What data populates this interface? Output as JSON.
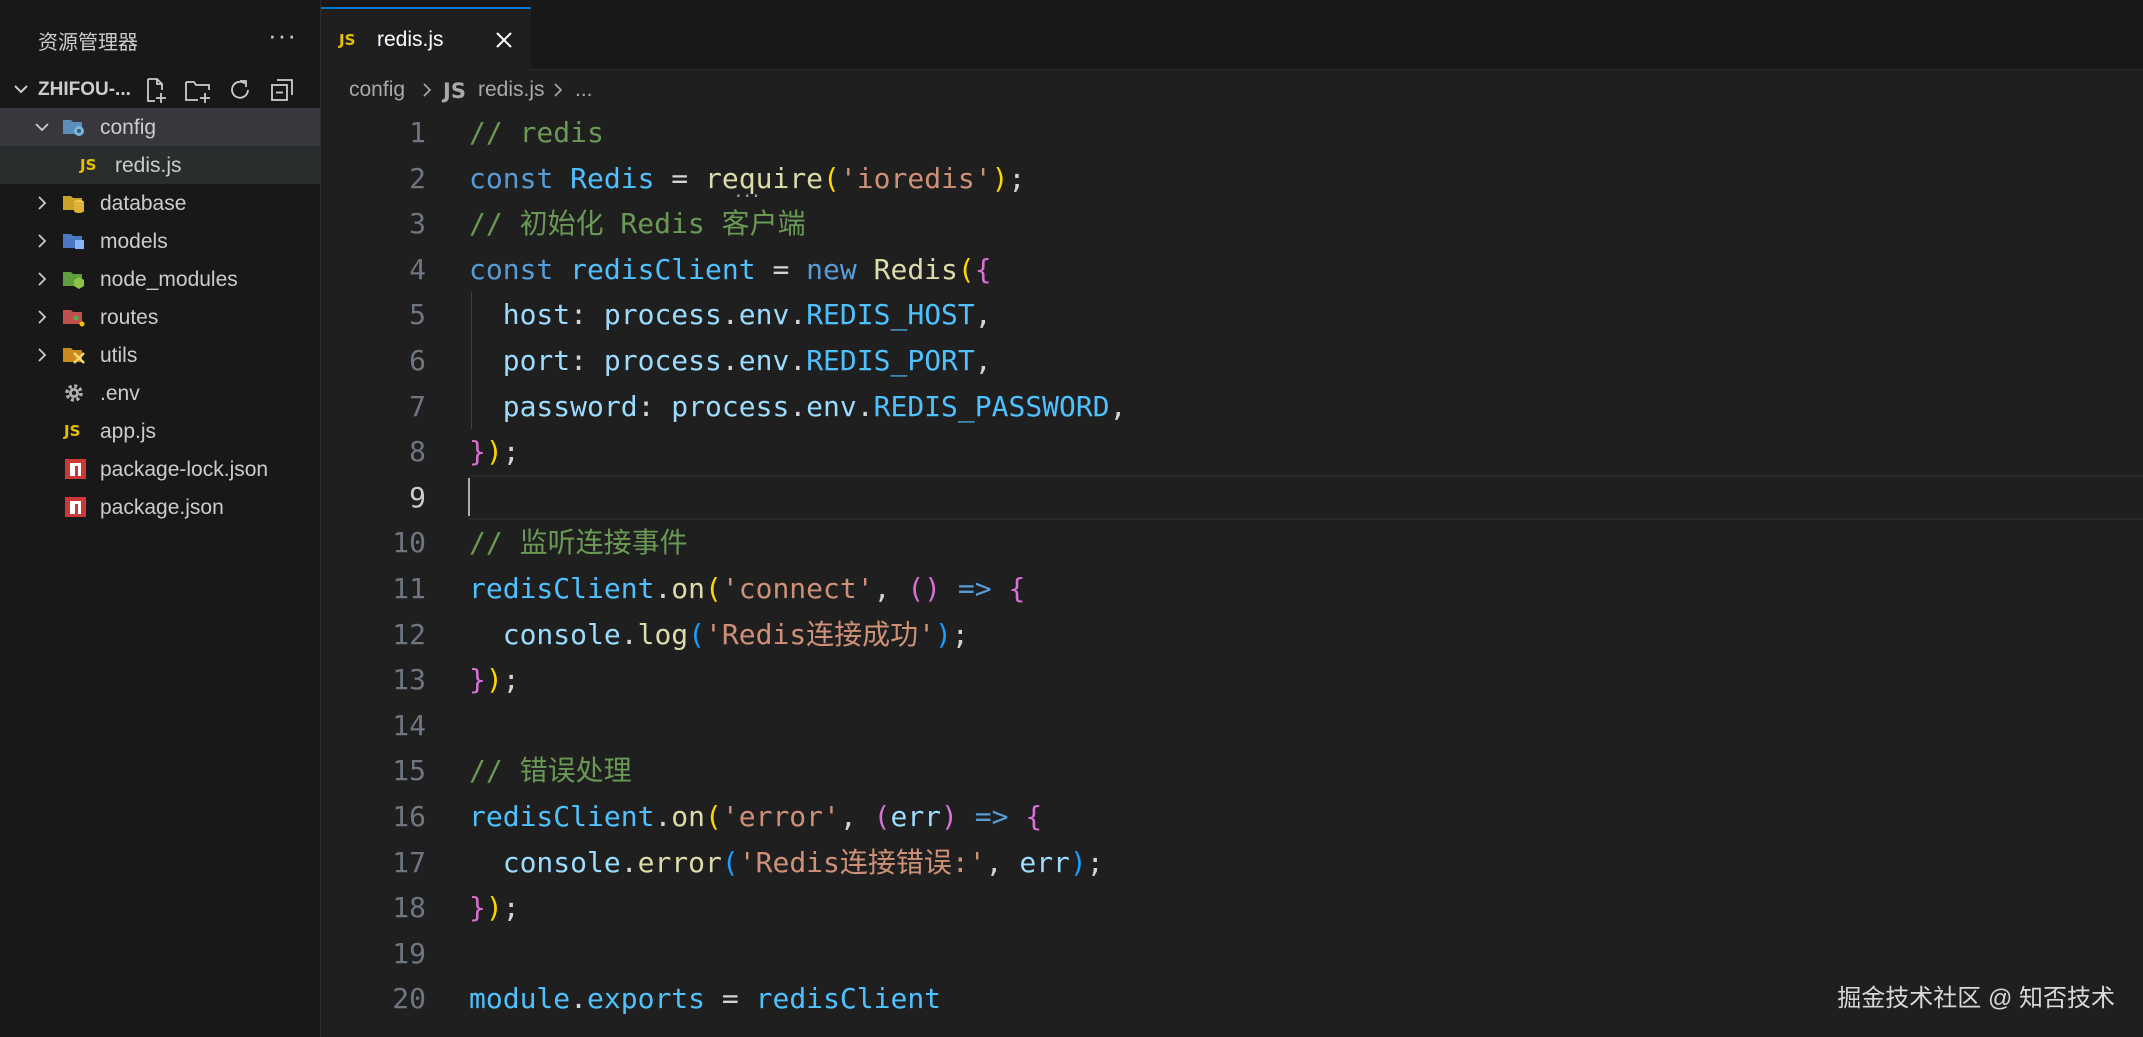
{
  "explorer": {
    "title": "资源管理器",
    "more": "···",
    "project_name": "ZHIFOU-...",
    "actions": [
      "new-file-icon",
      "new-folder-icon",
      "refresh-icon",
      "collapse-all-icon"
    ],
    "items": [
      {
        "label": "config",
        "type": "folder",
        "expanded": true,
        "icon": "config-folder-icon"
      },
      {
        "label": "redis.js",
        "type": "file",
        "icon": "JS"
      },
      {
        "label": "database",
        "type": "folder",
        "expanded": false,
        "icon": "database-folder-icon"
      },
      {
        "label": "models",
        "type": "folder",
        "expanded": false,
        "icon": "models-folder-icon"
      },
      {
        "label": "node_modules",
        "type": "folder",
        "expanded": false,
        "icon": "node-folder-icon"
      },
      {
        "label": "routes",
        "type": "folder",
        "expanded": false,
        "icon": "routes-folder-icon"
      },
      {
        "label": "utils",
        "type": "folder",
        "expanded": false,
        "icon": "utils-folder-icon"
      },
      {
        "label": ".env",
        "type": "file",
        "icon": "gear-icon"
      },
      {
        "label": "app.js",
        "type": "file",
        "icon": "JS"
      },
      {
        "label": "package-lock.json",
        "type": "file",
        "icon": "npm-icon"
      },
      {
        "label": "package.json",
        "type": "file",
        "icon": "npm-icon"
      }
    ]
  },
  "tab": {
    "icon": "JS",
    "label": "redis.js"
  },
  "breadcrumb": {
    "folder": "config",
    "icon": "JS",
    "file": "redis.js",
    "more": "..."
  },
  "editor": {
    "active_line": 9,
    "line_numbers": [
      "1",
      "2",
      "3",
      "4",
      "5",
      "6",
      "7",
      "8",
      "9",
      "10",
      "11",
      "12",
      "13",
      "14",
      "15",
      "16",
      "17",
      "18",
      "19",
      "20"
    ]
  },
  "code": {
    "l1": [
      "// redis"
    ],
    "l2": [
      "const",
      " ",
      "Redis",
      " = ",
      "require",
      "(",
      "'ioredis'",
      ")",
      ";"
    ],
    "l3": [
      "// 初始化 Redis 客户端"
    ],
    "l4": [
      "const",
      " ",
      "redisClient",
      " = ",
      "new",
      " ",
      "Redis",
      "(",
      "{"
    ],
    "l5": [
      "  ",
      "host",
      ": ",
      "process",
      ".",
      "env",
      ".",
      "REDIS_HOST",
      ","
    ],
    "l6": [
      "  ",
      "port",
      ": ",
      "process",
      ".",
      "env",
      ".",
      "REDIS_PORT",
      ","
    ],
    "l7": [
      "  ",
      "password",
      ": ",
      "process",
      ".",
      "env",
      ".",
      "REDIS_PASSWORD",
      ","
    ],
    "l8": [
      "}",
      ")",
      ";"
    ],
    "l10": [
      "// 监听连接事件"
    ],
    "l11": [
      "redisClient",
      ".",
      "on",
      "(",
      "'connect'",
      ", ",
      "()",
      " ",
      "=>",
      " ",
      "{"
    ],
    "l12": [
      "  ",
      "console",
      ".",
      "log",
      "(",
      "'Redis连接成功'",
      ")",
      ";"
    ],
    "l13": [
      "}",
      ")",
      ";"
    ],
    "l15": [
      "// 错误处理"
    ],
    "l16": [
      "redisClient",
      ".",
      "on",
      "(",
      "'error'",
      ", ",
      "(",
      "err",
      ")",
      " ",
      "=>",
      " ",
      "{"
    ],
    "l17": [
      "  ",
      "console",
      ".",
      "error",
      "(",
      "'Redis连接错误:'",
      ", ",
      "err",
      ")",
      ";"
    ],
    "l18": [
      "}",
      ")",
      ";"
    ],
    "l20": [
      "module",
      ".",
      "exports",
      " = ",
      "redisClient"
    ]
  },
  "watermark": "掘金技术社区 @ 知否技术",
  "colors": {
    "accent": "#0078d4",
    "comment": "#6a9955",
    "keyword": "#569cd6",
    "string": "#ce9178",
    "function": "#dcdcaa",
    "variable": "#9cdcfe",
    "constant": "#4fc1ff",
    "bracket_gold": "#ffd700",
    "bracket_purple": "#da70d6",
    "bracket_blue": "#179fff"
  }
}
